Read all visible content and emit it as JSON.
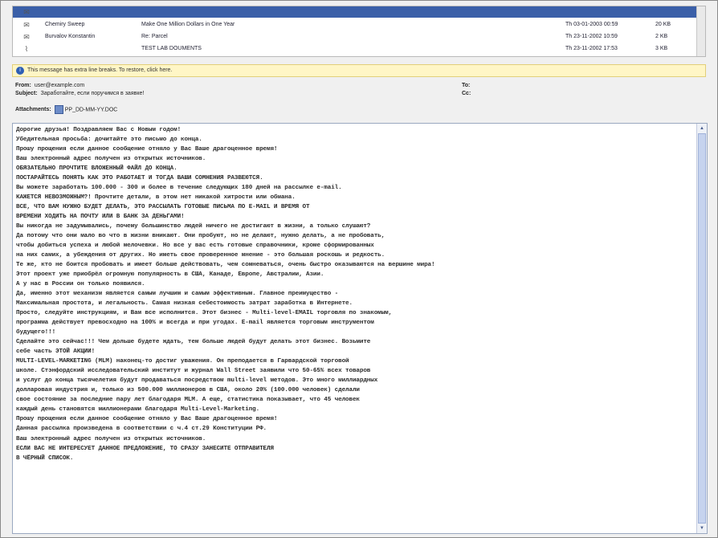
{
  "message_list": [
    {
      "from": "",
      "subject": "",
      "date": "",
      "size": "",
      "selected": true
    },
    {
      "from": "Chemiry Sweep",
      "subject": "Make One Million Dollars in One Year",
      "date": "Th 03-01-2003 00:59",
      "size": "20 KB",
      "selected": false
    },
    {
      "from": "Burvalov Konstantin",
      "subject": "Re: Parcel",
      "date": "Th 23-11-2002 10:59",
      "size": "2 KB",
      "selected": false
    },
    {
      "from": "",
      "subject": "TEST LAB DOUMENTS",
      "date": "Th 23-11-2002 17:53",
      "size": "3 KB",
      "selected": false
    }
  ],
  "infobar": {
    "text": "This message has extra line breaks. To restore, click here."
  },
  "headers": {
    "from_label": "From:",
    "from_value": "user@example.com",
    "subject_label": "Subject:",
    "subject_value": "Заработайте, если поручимся в заявке!",
    "to_label": "To:",
    "cc_label": "Cc:",
    "attachments_label": "Attachments:",
    "attachment_name": "PP_DD-MM-YY.DOC"
  },
  "body": {
    "text": "Дорогие друзья! Поздравляем Вас с Новым годом!\nУбедительная просьба: дочитайте это письмо до конца.\nПрошу прощения если данное сообщение отняло у Вас Ваше драгоценное время!\nВаш электронный адрес получен из открытых источников.\nОБЯЗАТЕЛЬНО ПРОЧТИТЕ ВЛОЖЕННЫЙ ФАЙЛ ДО КОНЦА.\nПОСТАРАЙТЕСЬ ПОНЯТЬ КАК ЭТО РАБОТАЕТ И ТОГДА ВАШИ СОМНЕНИЯ РАЗВЕЮТСЯ.\nВы можете заработать 100.000 - 300 и более в течение следующих 180 дней на рассылке e-mail.\nКАЖЕТСЯ НЕВОЗМОЖНЫМ?! Прочтите детали, в этом нет никакой хитрости или обмана.\nВСЕ, ЧТО ВАМ НУЖНО БУДЕТ ДЕЛАТЬ, ЭТО РАССЫЛАТЬ ГОТОВЫЕ ПИСЬМА ПО E-MAIL И ВРЕМЯ ОТ\nВРЕМЕНИ ХОДИТЬ НА ПОЧТУ ИЛИ В БАНК ЗА ДЕНЬГАМИ!\nВы никогда не задумывались, почему большинство людей ничего не достигают в жизни, а только слушают?\nДа потому что они мало во что в жизни вникают. Они пробуют, но не делают, нужно делать, а не пробовать,\nчтобы добиться успеха и любой мелочевки. Но все у вас есть готовые справочники, кроме сформированных\nна них самих, а убеждения от других. Но иметь свое проверенное мнение - это большая роскошь и редкость.\nТе же, кто не боится пробовать и имеет больше действовать, чем сомневаться, очень быстро оказываются на вершине мира!\nЭтот проект уже приобрёл огромную популярность в США, Канаде, Европе, Австралии, Азии.\nА у нас в России он только появился.\nДа, именно этот механизм является самым лучшим и самым эффективным. Главное преимущество -\nМаксимальная простота, и легальность. Самая низкая себестоимость затрат заработка в Интернете.\nПросто, следуйте инструкциям, и Вам все исполнится. Этот бизнес - Multi-level-EMAIL торговля по знакомым,\nпрограмма действует превосходно на 100% и всегда и при угодах. E-mail является торговым инструментом\nбудущего!!!\nСделайте это сейчас!!! Чем дольше будете ждать, тем больше людей будут делать этот бизнес. Возьмите\nсебе часть ЭТОЙ АКЦИИ!\nMULTI-LEVEL-MARKETING (MLM) наконец-то достиг уважения. Он преподается в Гарвардской торговой\nшколе. Стэнфордский исследовательский институт и журнал Wall Street заявили что 50-65% всех товаров\nи услуг до конца тысячелетия будут продаваться посредством multi-level методов. Это много миллиардных\nдолларовая индустрия и, только из 500.000 миллионеров в США, около 20% (100.000 человек) сделали\nсвое состояние за последние пару лет благодаря MLM. А еще, статистика показывает, что 45 человек\nкаждый день становятся миллионерами благодаря Multi-Level-Marketing.\nПрошу прощения если данное сообщение отняло у Вас Ваше драгоценное время!\nДанная рассылка произведена в соответствии с ч.4 ст.29 Конституции РФ.\nВаш электронный адрес получен из открытых источников.\nЕСЛИ ВАС НЕ ИНТЕРЕСУЕТ ДАННОЕ ПРЕДЛОЖЕНИЕ, ТО СРАЗУ ЗАНЕСИТЕ ОТПРАВИТЕЛЯ\nВ ЧЁРНЫЙ СПИСОК."
  },
  "icons": {
    "envelope": "envelope-icon",
    "attachment": "paperclip-icon",
    "info": "info-icon",
    "scroll_up": "scroll-up-arrow-icon",
    "scroll_down": "scroll-down-arrow-icon"
  },
  "colors": {
    "selection": "#3a5fa8",
    "infobar_bg": "#fff6c6",
    "body_border": "#9aa8c0"
  }
}
